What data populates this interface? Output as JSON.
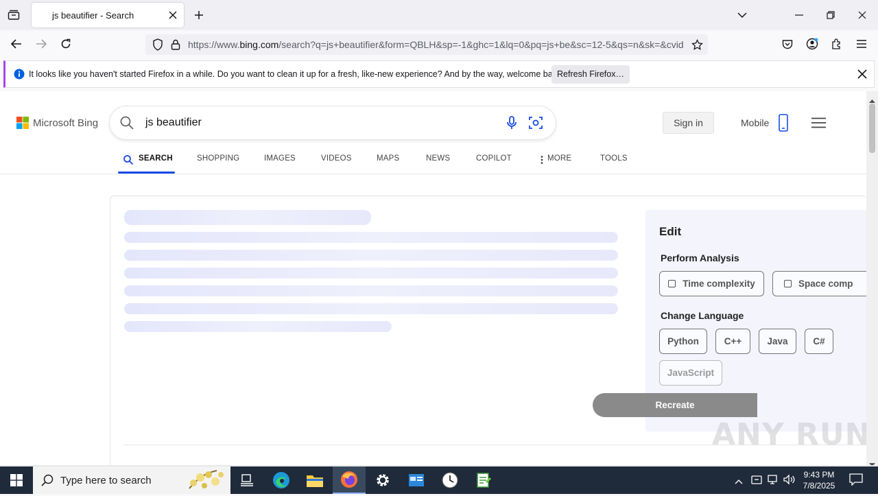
{
  "browser": {
    "tab_title": "js beautifier - Search",
    "url_prefix": "https://www.",
    "url_domain": "bing.com",
    "url_rest": "/search?q=js+beautifier&form=QBLH&sp=-1&ghc=1&lq=0&pq=js+be&sc=12-5&qs=n&sk=&cvid"
  },
  "notification": {
    "message": "It looks like you haven't started Firefox in a while. Do you want to clean it up for a fresh, like-new experience? And by the way, welcome back!",
    "button": "Refresh Firefox…"
  },
  "bing": {
    "logo_text": "Microsoft Bing",
    "query": "js beautifier",
    "sign_in": "Sign in",
    "mobile": "Mobile",
    "scopes": [
      "SEARCH",
      "SHOPPING",
      "IMAGES",
      "VIDEOS",
      "MAPS",
      "NEWS",
      "COPILOT",
      "MORE",
      "TOOLS"
    ]
  },
  "edit_panel": {
    "title": "Edit",
    "analysis_heading": "Perform Analysis",
    "analysis_options": [
      "Time complexity",
      "Space comp"
    ],
    "language_heading": "Change Language",
    "languages": [
      "Python",
      "C++",
      "Java",
      "C#",
      "JavaScript"
    ],
    "recreate": "Recreate"
  },
  "watermark": "ANY RUN",
  "taskbar": {
    "search_placeholder": "Type here to search",
    "time": "9:43 PM",
    "date": "7/8/2025"
  }
}
